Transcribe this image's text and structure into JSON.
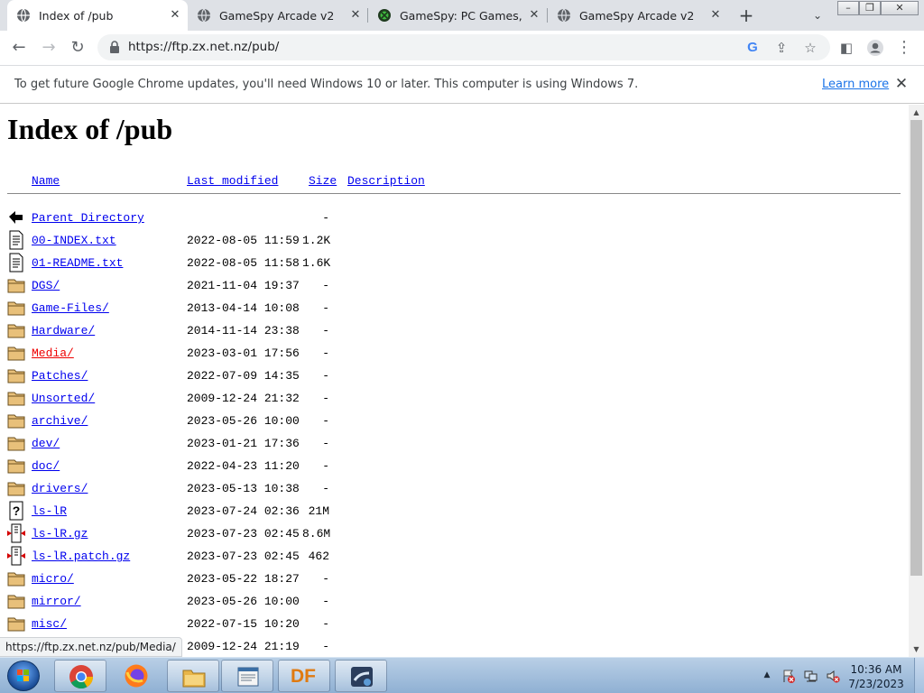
{
  "browser": {
    "tabs": [
      {
        "title": "Index of /pub",
        "active": true,
        "favicon": "globe-icon"
      },
      {
        "title": "GameSpy Arcade v2",
        "active": false,
        "favicon": "globe-icon"
      },
      {
        "title": "GameSpy: PC Games, Rev",
        "active": false,
        "favicon": "gamespy-icon"
      },
      {
        "title": "GameSpy Arcade v2",
        "active": false,
        "favicon": "globe-icon"
      }
    ],
    "url": "https://ftp.zx.net.nz/pub/",
    "colors": {
      "tabstrip": "#dee1e6",
      "link": "#0000ee",
      "link_hover": "#ee0000"
    }
  },
  "infobar": {
    "message": "To get future Google Chrome updates, you'll need Windows 10 or later. This computer is using Windows 7.",
    "learn_more": "Learn more"
  },
  "page": {
    "heading": "Index of /pub",
    "columns": {
      "name": "Name",
      "modified": "Last modified",
      "size": "Size",
      "description": "Description"
    },
    "rows": [
      {
        "name": "Parent Directory",
        "date": "",
        "size": "-",
        "icon": "back-arrow-icon"
      },
      {
        "name": "00-INDEX.txt",
        "date": "2022-08-05 11:59",
        "size": "1.2K",
        "icon": "text-file-icon"
      },
      {
        "name": "01-README.txt",
        "date": "2022-08-05 11:58",
        "size": "1.6K",
        "icon": "text-file-icon"
      },
      {
        "name": "DGS/",
        "date": "2021-11-04 19:37",
        "size": "-",
        "icon": "folder-icon"
      },
      {
        "name": "Game-Files/",
        "date": "2013-04-14 10:08",
        "size": "-",
        "icon": "folder-icon"
      },
      {
        "name": "Hardware/",
        "date": "2014-11-14 23:38",
        "size": "-",
        "icon": "folder-icon"
      },
      {
        "name": "Media/",
        "date": "2023-03-01 17:56",
        "size": "-",
        "icon": "folder-icon",
        "hover": true
      },
      {
        "name": "Patches/",
        "date": "2022-07-09 14:35",
        "size": "-",
        "icon": "folder-icon"
      },
      {
        "name": "Unsorted/",
        "date": "2009-12-24 21:32",
        "size": "-",
        "icon": "folder-icon"
      },
      {
        "name": "archive/",
        "date": "2023-05-26 10:00",
        "size": "-",
        "icon": "folder-icon"
      },
      {
        "name": "dev/",
        "date": "2023-01-21 17:36",
        "size": "-",
        "icon": "folder-icon"
      },
      {
        "name": "doc/",
        "date": "2022-04-23 11:20",
        "size": "-",
        "icon": "folder-icon"
      },
      {
        "name": "drivers/",
        "date": "2023-05-13 10:38",
        "size": "-",
        "icon": "folder-icon"
      },
      {
        "name": "ls-lR",
        "date": "2023-07-24 02:36",
        "size": "21M",
        "icon": "unknown-file-icon"
      },
      {
        "name": "ls-lR.gz",
        "date": "2023-07-23 02:45",
        "size": "8.6M",
        "icon": "compressed-file-icon"
      },
      {
        "name": "ls-lR.patch.gz",
        "date": "2023-07-23 02:45",
        "size": "462",
        "icon": "compressed-file-icon"
      },
      {
        "name": "micro/",
        "date": "2023-05-22 18:27",
        "size": "-",
        "icon": "folder-icon"
      },
      {
        "name": "mirror/",
        "date": "2023-05-26 10:00",
        "size": "-",
        "icon": "folder-icon"
      },
      {
        "name": "misc/",
        "date": "2022-07-15 10:20",
        "size": "-",
        "icon": "folder-icon"
      },
      {
        "name": "",
        "date": "2009-12-24 21:19",
        "size": "-",
        "icon": "folder-icon"
      }
    ]
  },
  "status_bar": {
    "text": "https://ftp.zx.net.nz/pub/Media/"
  },
  "taskbar": {
    "pinned": [
      {
        "name": "chrome",
        "icon": "chrome-icon"
      },
      {
        "name": "firefox",
        "icon": "firefox-icon"
      },
      {
        "name": "explorer",
        "icon": "folder-icon"
      },
      {
        "name": "notepad",
        "icon": "window-icon"
      },
      {
        "name": "df",
        "icon": "df-icon",
        "label": "DF"
      },
      {
        "name": "app",
        "icon": "app-icon"
      }
    ],
    "clock": {
      "time": "10:36 AM",
      "date": "7/23/2023"
    }
  }
}
